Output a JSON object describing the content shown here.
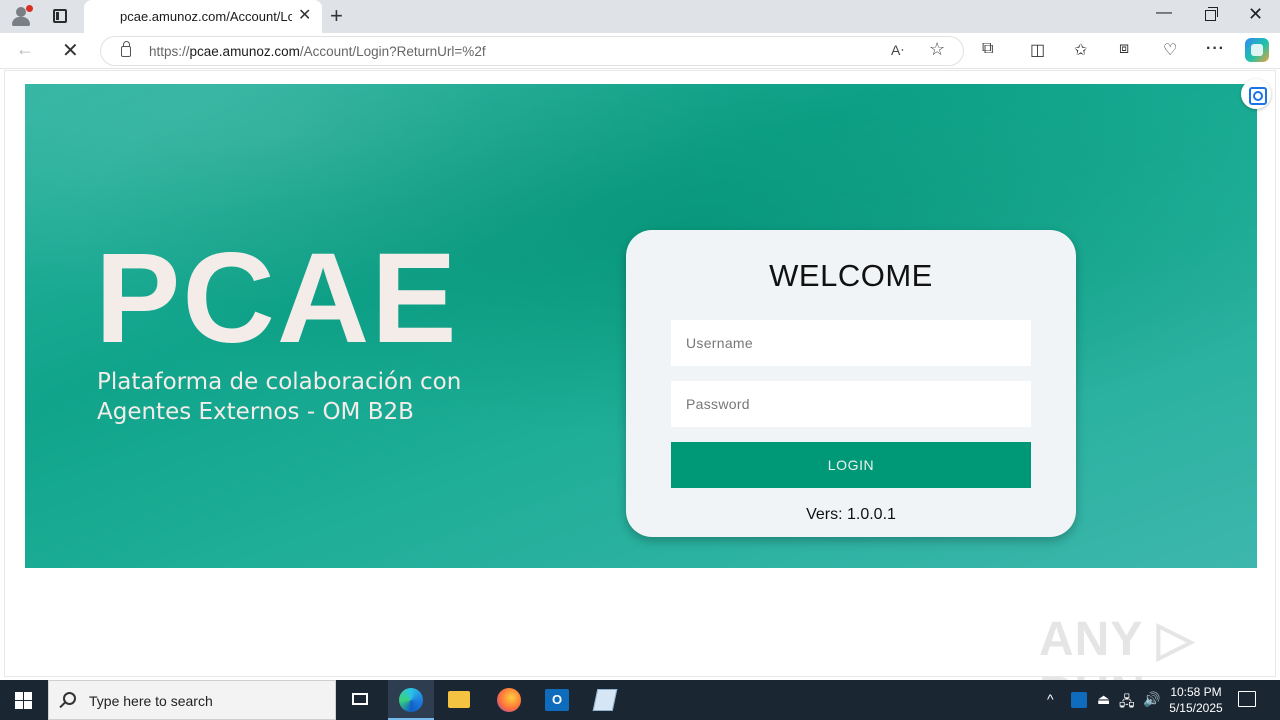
{
  "browser": {
    "tab_title": "pcae.amunoz.com/Account/Login",
    "tab_close_glyph": "✕",
    "new_tab_glyph": "+",
    "url_scheme": "https://",
    "url_host": "pcae.amunoz.com",
    "url_path": "/Account/Login?ReturnUrl=%2f",
    "icons": {
      "back": "←",
      "stop": "✕",
      "read_aloud": "Aᐧ",
      "favorite": "☆",
      "extensions": "⧉",
      "split": "◫",
      "favorites": "✩",
      "collections": "⧈",
      "performance": "♡",
      "more": "···"
    },
    "window": {
      "minimize": "—",
      "close": "✕"
    }
  },
  "page": {
    "brand": "PCAE",
    "tagline_line1": "Plataforma de colaboración con",
    "tagline_line2": "Agentes Externos - OM B2B",
    "login": {
      "title": "WELCOME",
      "username_placeholder": "Username",
      "password_placeholder": "Password",
      "button_label": "LOGIN",
      "version": "Vers: 1.0.0.1"
    },
    "watermark": "ANY ▷ RUN"
  },
  "taskbar": {
    "search_placeholder": "Type here to search",
    "tray": {
      "chevron": "^",
      "usb": "⏏",
      "network": "🖧",
      "volume": "🔊"
    },
    "outlook_letter": "O",
    "time": "10:58 PM",
    "date": "5/15/2025"
  },
  "colors": {
    "accent": "#009978",
    "hero_teal": "#10a48b",
    "brand_text": "#f3ece8",
    "card_bg": "#f1f4f6",
    "taskbar_bg": "#1b2633"
  }
}
